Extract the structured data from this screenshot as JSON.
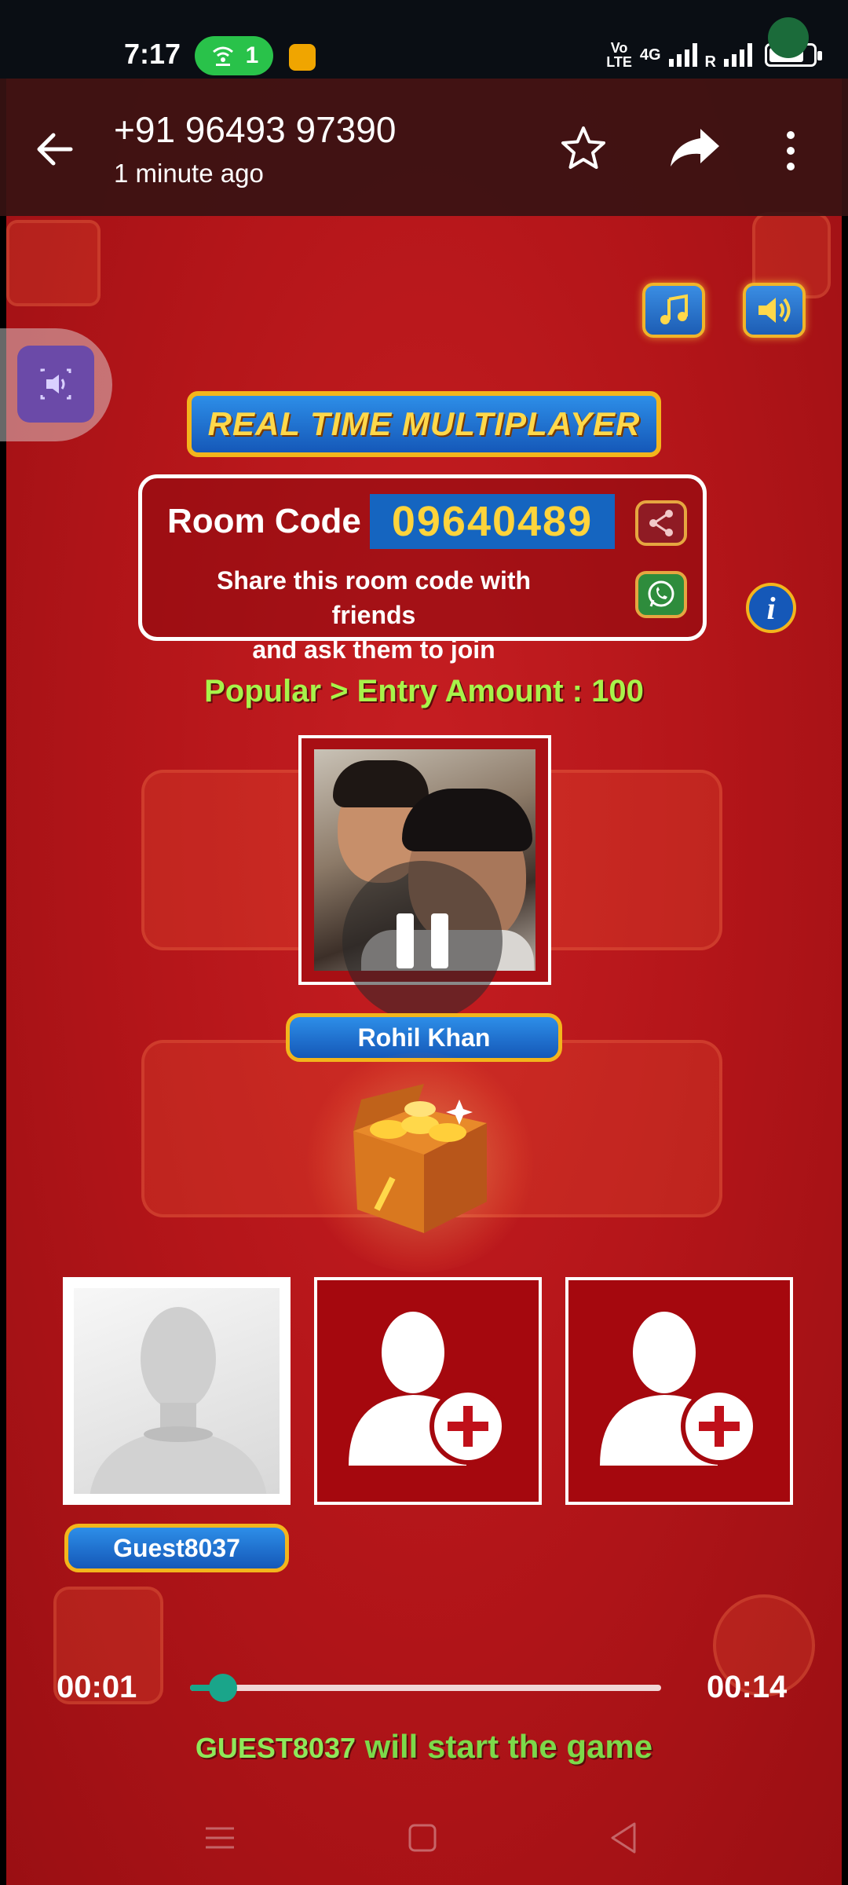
{
  "status_bar": {
    "time": "7:17",
    "hotspot_count": "1",
    "network_label_top": "Vo",
    "network_label_bottom": "LTE",
    "net_type": "4G",
    "roaming": "R"
  },
  "header": {
    "title": "+91 96493 97390",
    "subtitle": "1 minute ago",
    "icons": [
      "back-arrow-icon",
      "star-icon",
      "forward-icon",
      "more-vert-icon"
    ]
  },
  "game": {
    "banner": "REAL TIME MULTIPLAYER",
    "room_code_label": "Room Code :",
    "room_code": "09640489",
    "share_hint_line1": "Share this room code with friends",
    "share_hint_line2": "and ask them to join",
    "entry_info": "Popular > Entry Amount : 100",
    "host_name": "Rohil Khan",
    "guest_name": "Guest8037",
    "start_player": "GUEST8037",
    "start_text": "will start the game",
    "info_glyph": "i"
  },
  "player": {
    "current_time": "00:01",
    "total_time": "00:14",
    "progress": 0.07
  },
  "colors": {
    "accent_green": "#1aa58a",
    "game_red": "#b31519",
    "gold": "#f3b51c",
    "blue": "#1558b8"
  }
}
